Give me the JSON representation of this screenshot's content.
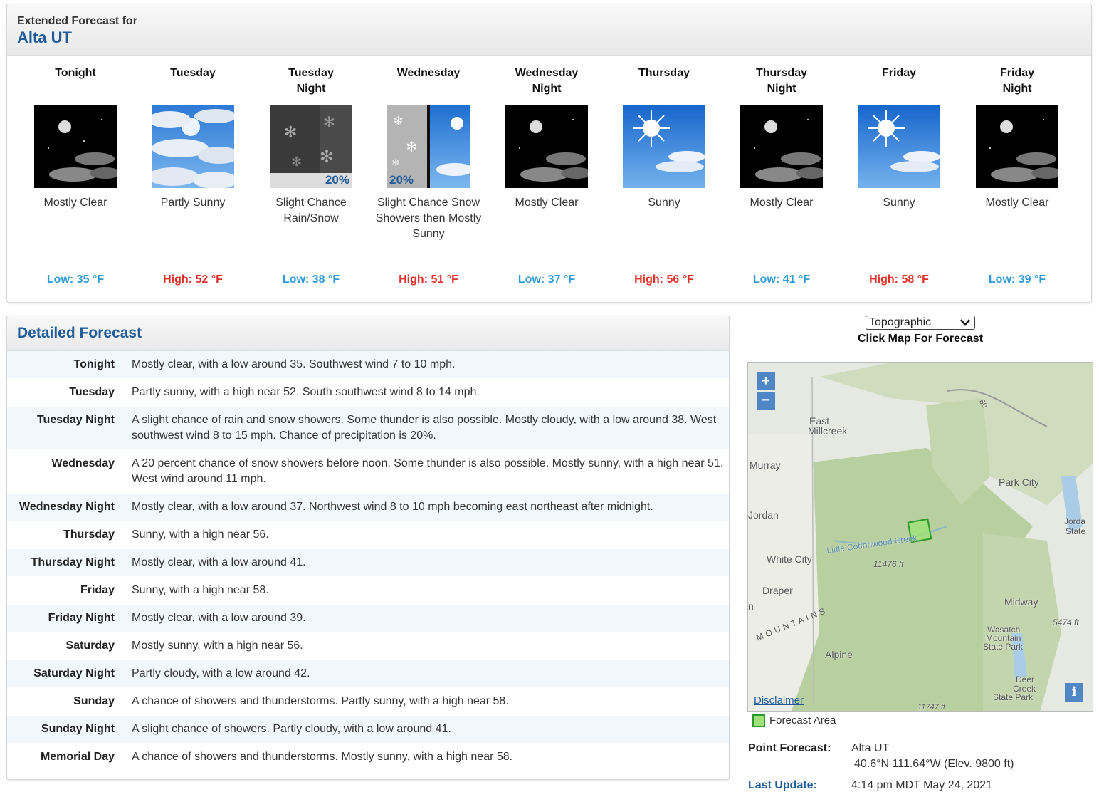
{
  "extended": {
    "heading_small": "Extended Forecast for",
    "heading_location": "Alta UT",
    "periods": [
      {
        "name_l1": "Tonight",
        "name_l2": "",
        "desc": "Mostly Clear",
        "temp": "Low: 35 °F",
        "icon": "mostly-clear-night-icon",
        "kind": "lo"
      },
      {
        "name_l1": "Tuesday",
        "name_l2": "",
        "desc": "Partly Sunny",
        "temp": "High: 52 °F",
        "icon": "partly-sunny-icon",
        "kind": "hi"
      },
      {
        "name_l1": "Tuesday",
        "name_l2": "Night",
        "desc": "Slight Chance Rain/Snow",
        "temp": "Low: 38 °F",
        "icon": "rain-snow-icon",
        "pct": "20%",
        "kind": "lo"
      },
      {
        "name_l1": "Wednesday",
        "name_l2": "",
        "desc": "Slight Chance Snow Showers then Mostly Sunny",
        "temp": "High: 51 °F",
        "icon": "snow-then-sunny-icon",
        "pct": "20%",
        "kind": "hi"
      },
      {
        "name_l1": "Wednesday",
        "name_l2": "Night",
        "desc": "Mostly Clear",
        "temp": "Low: 37 °F",
        "icon": "mostly-clear-night-icon",
        "kind": "lo"
      },
      {
        "name_l1": "Thursday",
        "name_l2": "",
        "desc": "Sunny",
        "temp": "High: 56 °F",
        "icon": "sunny-icon",
        "kind": "hi"
      },
      {
        "name_l1": "Thursday",
        "name_l2": "Night",
        "desc": "Mostly Clear",
        "temp": "Low: 41 °F",
        "icon": "mostly-clear-night-icon",
        "kind": "lo"
      },
      {
        "name_l1": "Friday",
        "name_l2": "",
        "desc": "Sunny",
        "temp": "High: 58 °F",
        "icon": "sunny-icon",
        "kind": "hi"
      },
      {
        "name_l1": "Friday",
        "name_l2": "Night",
        "desc": "Mostly Clear",
        "temp": "Low: 39 °F",
        "icon": "mostly-clear-night-icon",
        "kind": "lo"
      }
    ]
  },
  "detailed": {
    "title": "Detailed Forecast",
    "rows": [
      {
        "label": "Tonight",
        "text": "Mostly clear, with a low around 35. Southwest wind 7 to 10 mph."
      },
      {
        "label": "Tuesday",
        "text": "Partly sunny, with a high near 52. South southwest wind 8 to 14 mph."
      },
      {
        "label": "Tuesday Night",
        "text": "A slight chance of rain and snow showers. Some thunder is also possible. Mostly cloudy, with a low around 38. West southwest wind 8 to 15 mph. Chance of precipitation is 20%."
      },
      {
        "label": "Wednesday",
        "text": "A 20 percent chance of snow showers before noon. Some thunder is also possible. Mostly sunny, with a high near 51. West wind around 11 mph."
      },
      {
        "label": "Wednesday Night",
        "text": "Mostly clear, with a low around 37. Northwest wind 8 to 10 mph becoming east northeast after midnight."
      },
      {
        "label": "Thursday",
        "text": "Sunny, with a high near 56."
      },
      {
        "label": "Thursday Night",
        "text": "Mostly clear, with a low around 41."
      },
      {
        "label": "Friday",
        "text": "Sunny, with a high near 58."
      },
      {
        "label": "Friday Night",
        "text": "Mostly clear, with a low around 39."
      },
      {
        "label": "Saturday",
        "text": "Mostly sunny, with a high near 56."
      },
      {
        "label": "Saturday Night",
        "text": "Partly cloudy, with a low around 42."
      },
      {
        "label": "Sunday",
        "text": "A chance of showers and thunderstorms. Partly sunny, with a high near 58."
      },
      {
        "label": "Sunday Night",
        "text": "A slight chance of showers. Partly cloudy, with a low around 41."
      },
      {
        "label": "Memorial Day",
        "text": "A chance of showers and thunderstorms. Mostly sunny, with a high near 58."
      }
    ]
  },
  "map": {
    "select_value": "Topographic",
    "caption": "Click Map For Forecast",
    "zoom_in": "+",
    "zoom_out": "−",
    "disclaimer": "Disclaimer",
    "info": "i",
    "legend": "Forecast Area",
    "labels": {
      "east_millcreek_1": "East",
      "east_millcreek_2": "Millcreek",
      "murray": "Murray",
      "park_city": "Park City",
      "jordan": "Jordan",
      "jordan_state_1": "Jorda",
      "jordan_state_2": "State",
      "little_cottonwood": "Little Cottonwood Creek",
      "white_city": "White City",
      "elev1": "11476 ft",
      "draper": "Draper",
      "n": "n",
      "midway": "Midway",
      "elev2": "5474 ft",
      "mountains": "MOUNTAINS",
      "wasatch_1": "Wasatch",
      "wasatch_2": "Mountain",
      "wasatch_3": "State Park",
      "alpine": "Alpine",
      "deer_1": "Deer",
      "deer_2": "Creek",
      "deer_3": "State Park",
      "route": "80",
      "elev3": "11747 ft"
    }
  },
  "point": {
    "label": "Point Forecast:",
    "name": "Alta UT",
    "coords": "40.6°N 111.64°W (Elev. 9800 ft)",
    "update_label": "Last Update:",
    "update_value": "4:14 pm MDT May 24, 2021"
  }
}
